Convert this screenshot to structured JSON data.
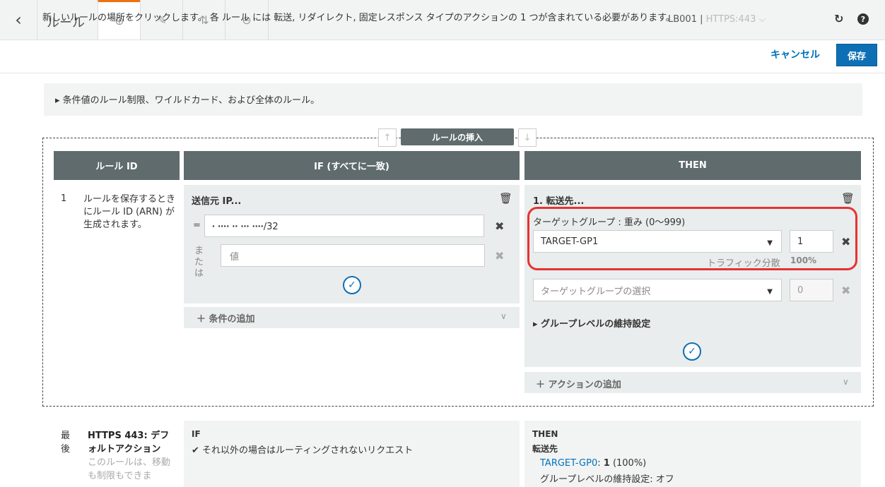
{
  "header": {
    "title": "ルール",
    "lb_name": "LB001",
    "separator": "|",
    "listener": "HTTPS:443",
    "listener_chevron": "⌵"
  },
  "tabs": [
    {
      "name": "add",
      "icon": "plus-circle-icon",
      "glyph": "⊕"
    },
    {
      "name": "edit",
      "icon": "pencil-icon",
      "glyph": "✎"
    },
    {
      "name": "reorder",
      "icon": "reorder-icon",
      "glyph": "⇅"
    },
    {
      "name": "delete",
      "icon": "minus-circle-icon",
      "glyph": "⊖"
    }
  ],
  "instruction": {
    "text": "新しいルールの場所をクリックします。 各 ルール には 転送, リダイレクト, 固定レスポンス タイプのアクションの 1 つが含まれている必要があります。",
    "cancel": "キャンセル",
    "save": "保存"
  },
  "info_box": "▸ 条件値のルール制限、ワイルドカード、および全体のルール。",
  "insert_rule": "ルールの挿入",
  "columns": {
    "rule_id": "ルール ID",
    "if": "IF (すべてに一致)",
    "then": "THEN"
  },
  "new_rule": {
    "number": "1",
    "description": "ルールを保存するときにルール ID (ARN) が生成されます。",
    "condition_title": "送信元 IP...",
    "eq": "=",
    "ip_value": "ꞏ ꞏꞏꞏꞏ ꞏꞏ ꞏꞏꞏ ꞏꞏꞏꞏ/32",
    "or_label": "または",
    "value_placeholder": "値",
    "add_condition": "条件の追加",
    "action_title": "1. 転送先...",
    "tg_weight_label": "ターゲットグループ : 重み (0〜999)",
    "tg1": "TARGET-GP1",
    "tg1_weight": "1",
    "traffic_label": "トラフィック分散",
    "traffic_value": "100%",
    "tg2_placeholder": "ターゲットグループの選択",
    "tg2_weight": "0",
    "stickiness": "▸ グループレベルの維持設定",
    "add_action": "アクションの追加"
  },
  "last_rule": {
    "number": "最後",
    "title": "HTTPS 443: デフォルトアクション",
    "note": "このルールは、移動も制限もできま",
    "if_label": "IF",
    "if_text": "✔ それ以外の場合はルーティングされないリクエスト",
    "then_label": "THEN",
    "forward": "転送先",
    "tg_name": "TARGET-GP0",
    "tg_sep": ": ",
    "tg_weight": "1",
    "tg_pct": " (100%)",
    "stickiness": "グループレベルの維持設定: オフ"
  },
  "colors": {
    "accent": "#ec7211",
    "primary": "#0f6fb4",
    "highlight": "#e53333",
    "header_bg": "#5f6b6d"
  }
}
